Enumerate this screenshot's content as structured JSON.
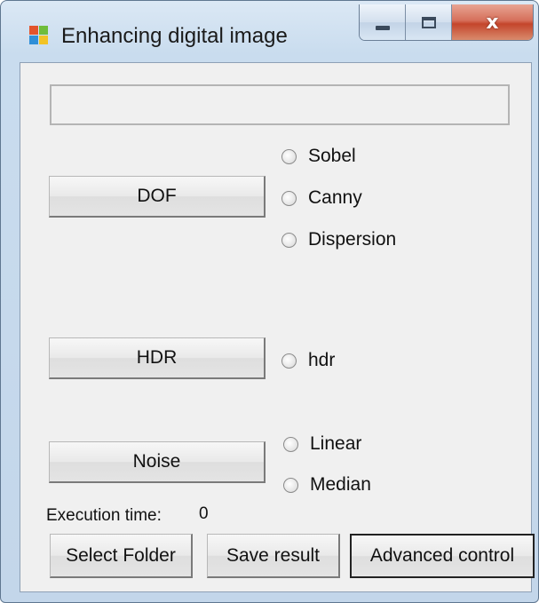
{
  "window": {
    "title": "Enhancing digital image",
    "minimize_glyph": "",
    "maximize_glyph": "",
    "close_glyph": "x"
  },
  "folder_path": "",
  "dof": {
    "button_label": "DOF",
    "options": [
      "Sobel",
      "Canny",
      "Dispersion"
    ]
  },
  "hdr": {
    "button_label": "HDR",
    "options": [
      "hdr"
    ]
  },
  "noise": {
    "button_label": "Noise",
    "options": [
      "Linear",
      "Median"
    ]
  },
  "execution": {
    "label": "Execution time:",
    "value": "0"
  },
  "footer": {
    "select_folder": "Select Folder",
    "save_result": "Save result",
    "advanced_control": "Advanced control"
  },
  "icons": {
    "app": "app-windows-icon",
    "minimize": "minimize-icon",
    "maximize": "maximize-icon",
    "close": "close-icon"
  },
  "colors": {
    "client_bg": "#f0f0f0",
    "close_button": "#c4452b",
    "titlebar": "#c9dcee"
  }
}
